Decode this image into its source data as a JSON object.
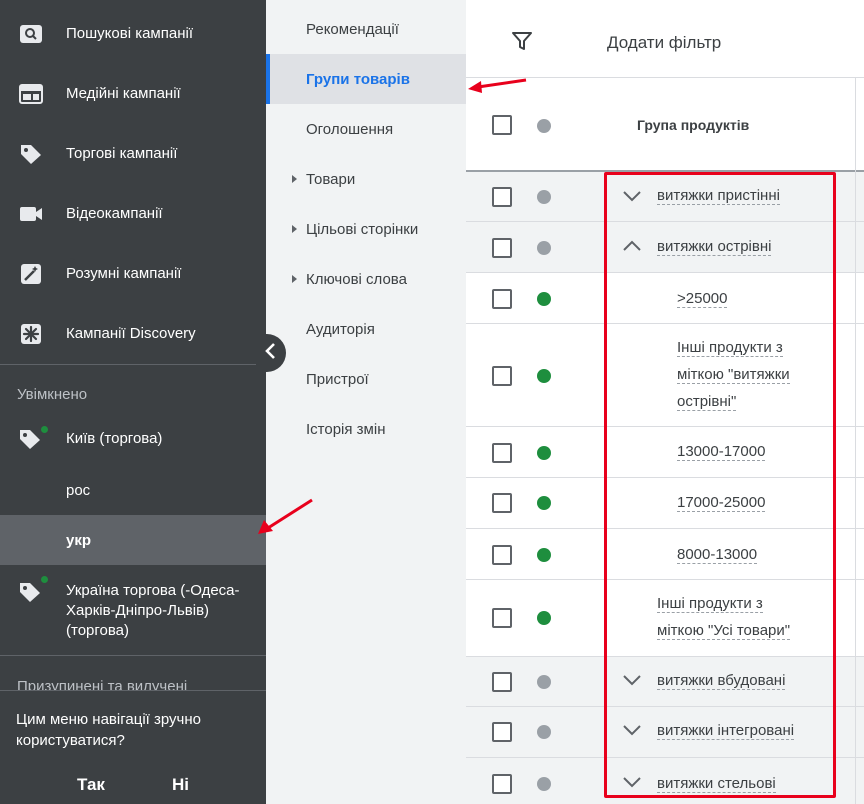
{
  "sidebar": {
    "nav": [
      {
        "label": "Пошукові кампанії",
        "icon": "search-campaign-icon"
      },
      {
        "label": "Медійні кампанії",
        "icon": "display-campaign-icon"
      },
      {
        "label": "Торгові кампанії",
        "icon": "shopping-tag-icon"
      },
      {
        "label": "Відеокампанії",
        "icon": "video-camera-icon"
      },
      {
        "label": "Розумні кампанії",
        "icon": "magic-wand-icon"
      },
      {
        "label": "Кампанії Discovery",
        "icon": "asterisk-icon"
      }
    ],
    "enabled_title": "Увімкнено",
    "campaigns": [
      {
        "label": "Київ (торгова)"
      },
      {
        "label": "рос"
      },
      {
        "label": "укр"
      },
      {
        "label": "Україна торгова (-Одеса-Харків-Дніпро-Львів) (торгова)"
      }
    ],
    "paused_title": "Призупинені та вилучені",
    "feedback": {
      "question": "Цим меню навігації зручно користуватися?",
      "yes": "Так",
      "no": "Ні"
    }
  },
  "submenu": {
    "items": [
      {
        "label": "Рекомендації"
      },
      {
        "label": "Групи товарів"
      },
      {
        "label": "Оголошення"
      },
      {
        "label": "Товари"
      },
      {
        "label": "Цільові сторінки"
      },
      {
        "label": "Ключові слова"
      },
      {
        "label": "Аудиторія"
      },
      {
        "label": "Пристрої"
      },
      {
        "label": "Історія змін"
      }
    ]
  },
  "table": {
    "filter_label": "Додати фільтр",
    "column_header": "Група продуктів",
    "rows": [
      {
        "text": "витяжки пристінні"
      },
      {
        "text": "витяжки острівні"
      },
      {
        "text": ">25000"
      },
      {
        "text": "Інші продукти з міткою \"витяжки острівні\""
      },
      {
        "text": "13000-17000"
      },
      {
        "text": "17000-25000"
      },
      {
        "text": "8000-13000"
      },
      {
        "text": "Інші продукти з міткою \"Усі товари\""
      },
      {
        "text": "витяжки вбудовані"
      },
      {
        "text": "витяжки інтегровані"
      },
      {
        "text": "витяжки стельові"
      }
    ]
  },
  "colors": {
    "sidebar_bg": "#3c4043",
    "accent": "#1a73e8",
    "status_enabled": "#1e8e3e",
    "annotation": "#e8001c"
  }
}
